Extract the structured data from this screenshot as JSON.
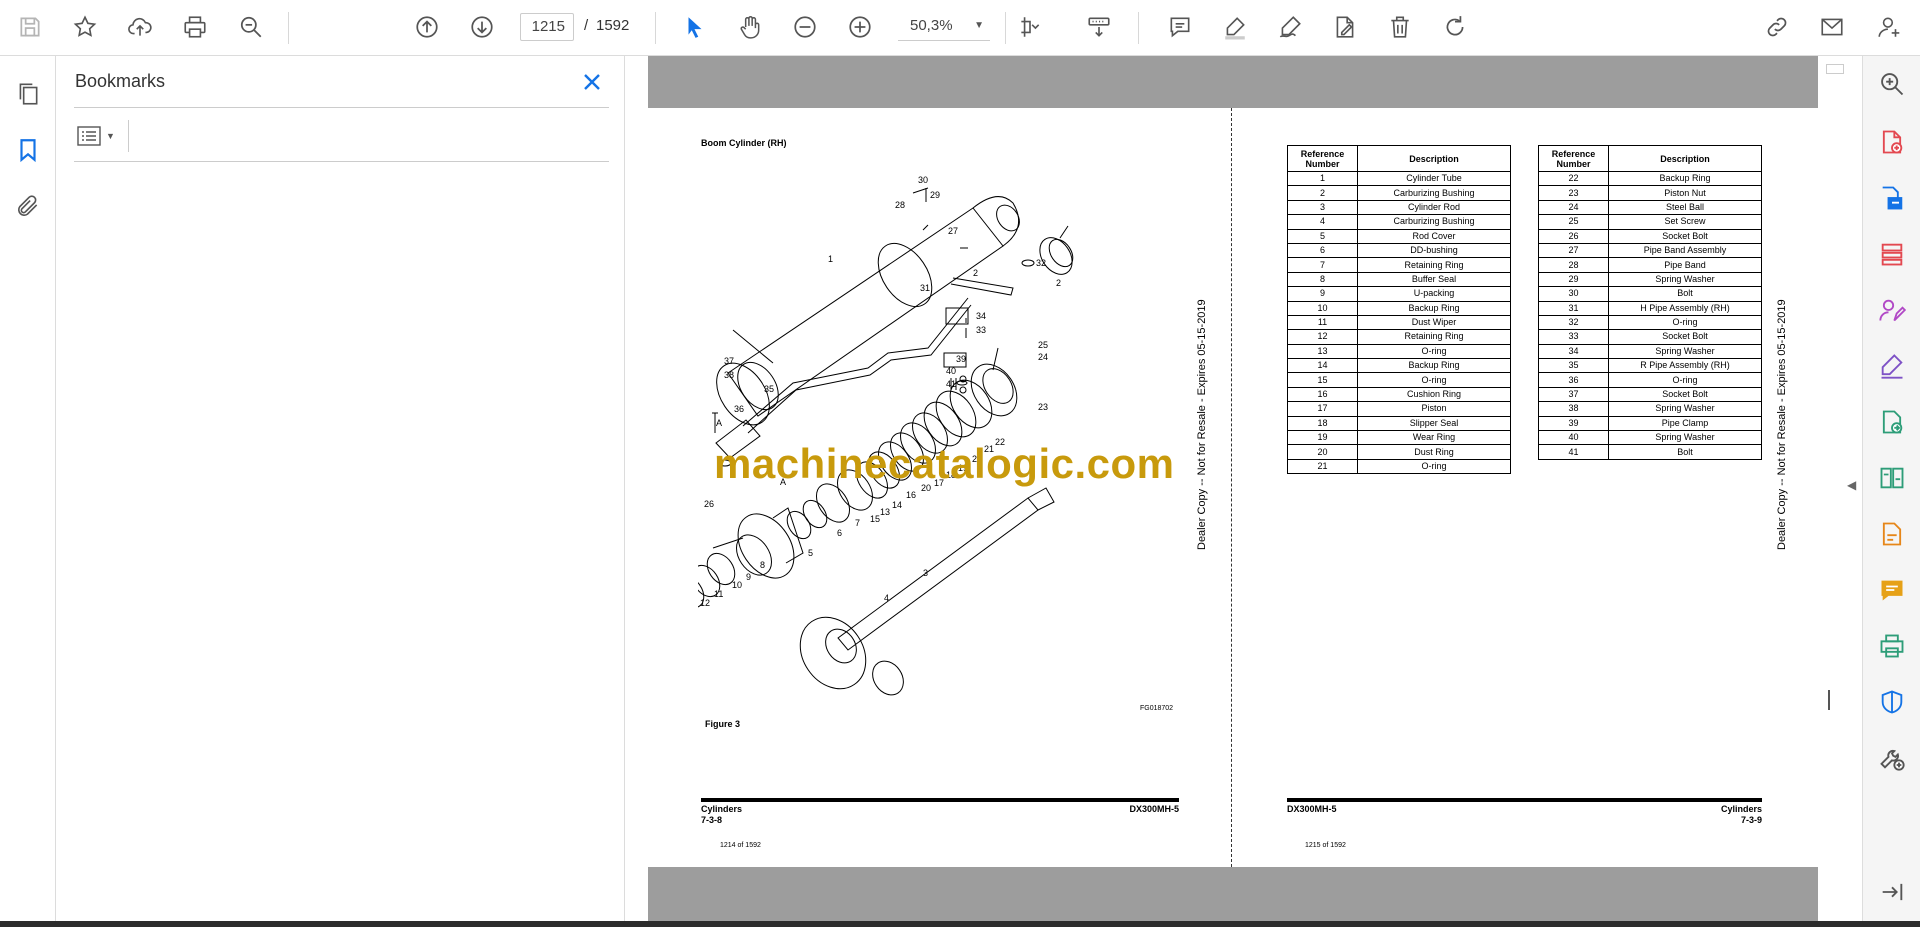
{
  "toolbar": {
    "page_current": "1215",
    "page_separator": "/",
    "page_total": "1592",
    "zoom": "50,3%"
  },
  "bookmarks_panel": {
    "title": "Bookmarks"
  },
  "document": {
    "left_page": {
      "figure_title": "Boom Cylinder (RH)",
      "figure_caption": "Figure 3",
      "figure_code": "FG018702",
      "callout_A_top": "A",
      "callout_A_bottom": "A",
      "footer_left_title": "Cylinders",
      "footer_left_num": "7-3-8",
      "footer_right": "DX300MH-5",
      "page_count": "1214 of 1592",
      "side_text": "Dealer Copy -- Not for Resale - Expires 05-15-2019"
    },
    "right_page": {
      "footer_left": "DX300MH-5",
      "footer_right_title": "Cylinders",
      "footer_right_num": "7-3-9",
      "page_count": "1215 of 1592",
      "side_text": "Dealer Copy -- Not for Resale - Expires 05-15-2019",
      "table_headers": {
        "ref": "Reference Number",
        "desc": "Description"
      },
      "table1": [
        {
          "num": "1",
          "desc": "Cylinder Tube"
        },
        {
          "num": "2",
          "desc": "Carburizing Bushing"
        },
        {
          "num": "3",
          "desc": "Cylinder Rod"
        },
        {
          "num": "4",
          "desc": "Carburizing Bushing"
        },
        {
          "num": "5",
          "desc": "Rod Cover"
        },
        {
          "num": "6",
          "desc": "DD-bushing"
        },
        {
          "num": "7",
          "desc": "Retaining Ring"
        },
        {
          "num": "8",
          "desc": "Buffer Seal"
        },
        {
          "num": "9",
          "desc": "U-packing"
        },
        {
          "num": "10",
          "desc": "Backup Ring"
        },
        {
          "num": "11",
          "desc": "Dust Wiper"
        },
        {
          "num": "12",
          "desc": "Retaining Ring"
        },
        {
          "num": "13",
          "desc": "O-ring"
        },
        {
          "num": "14",
          "desc": "Backup Ring"
        },
        {
          "num": "15",
          "desc": "O-ring"
        },
        {
          "num": "16",
          "desc": "Cushion Ring"
        },
        {
          "num": "17",
          "desc": "Piston"
        },
        {
          "num": "18",
          "desc": "Slipper Seal"
        },
        {
          "num": "19",
          "desc": "Wear Ring"
        },
        {
          "num": "20",
          "desc": "Dust Ring"
        },
        {
          "num": "21",
          "desc": "O-ring"
        }
      ],
      "table2": [
        {
          "num": "22",
          "desc": "Backup Ring"
        },
        {
          "num": "23",
          "desc": "Piston Nut"
        },
        {
          "num": "24",
          "desc": "Steel Ball"
        },
        {
          "num": "25",
          "desc": "Set Screw"
        },
        {
          "num": "26",
          "desc": "Socket Bolt"
        },
        {
          "num": "27",
          "desc": "Pipe Band Assembly"
        },
        {
          "num": "28",
          "desc": "Pipe Band"
        },
        {
          "num": "29",
          "desc": "Spring Washer"
        },
        {
          "num": "30",
          "desc": "Bolt"
        },
        {
          "num": "31",
          "desc": "H Pipe Assembly (RH)"
        },
        {
          "num": "32",
          "desc": "O-ring"
        },
        {
          "num": "33",
          "desc": "Socket Bolt"
        },
        {
          "num": "34",
          "desc": "Spring Washer"
        },
        {
          "num": "35",
          "desc": "R Pipe Assembly (RH)"
        },
        {
          "num": "36",
          "desc": "O-ring"
        },
        {
          "num": "37",
          "desc": "Socket Bolt"
        },
        {
          "num": "38",
          "desc": "Spring Washer"
        },
        {
          "num": "39",
          "desc": "Pipe Clamp"
        },
        {
          "num": "40",
          "desc": "Spring Washer"
        },
        {
          "num": "41",
          "desc": "Bolt"
        }
      ]
    },
    "watermark": "machinecatalogic.com"
  },
  "icons": {
    "toolbar": [
      "save-icon",
      "bookmark-star-icon",
      "upload-cloud-icon",
      "print-icon",
      "search-zoom-icon",
      "prev-page-icon",
      "next-page-icon",
      "select-arrow-icon",
      "hand-icon",
      "zoom-out-icon",
      "zoom-in-icon",
      "fit-page-icon",
      "scroll-mode-icon",
      "comment-icon",
      "highlight-pen-icon",
      "draw-icon",
      "edit-page-icon",
      "delete-icon",
      "rotate-icon",
      "share-link-icon",
      "email-icon",
      "user-add-icon"
    ],
    "right_rail": [
      "search-zoom-icon",
      "create-pdf-icon",
      "export-pdf-icon",
      "organize-pages-icon",
      "fill-sign-icon",
      "request-signature-icon",
      "export-doc-icon",
      "compare-icon",
      "edit-pdf-icon",
      "comment-icon",
      "print-production-icon",
      "protect-icon",
      "more-tools-icon",
      "expand-panel-icon"
    ]
  },
  "colors": {
    "accent": "#1473e6",
    "watermark": "#c89a0c",
    "grey_bg": "#9d9d9d"
  }
}
